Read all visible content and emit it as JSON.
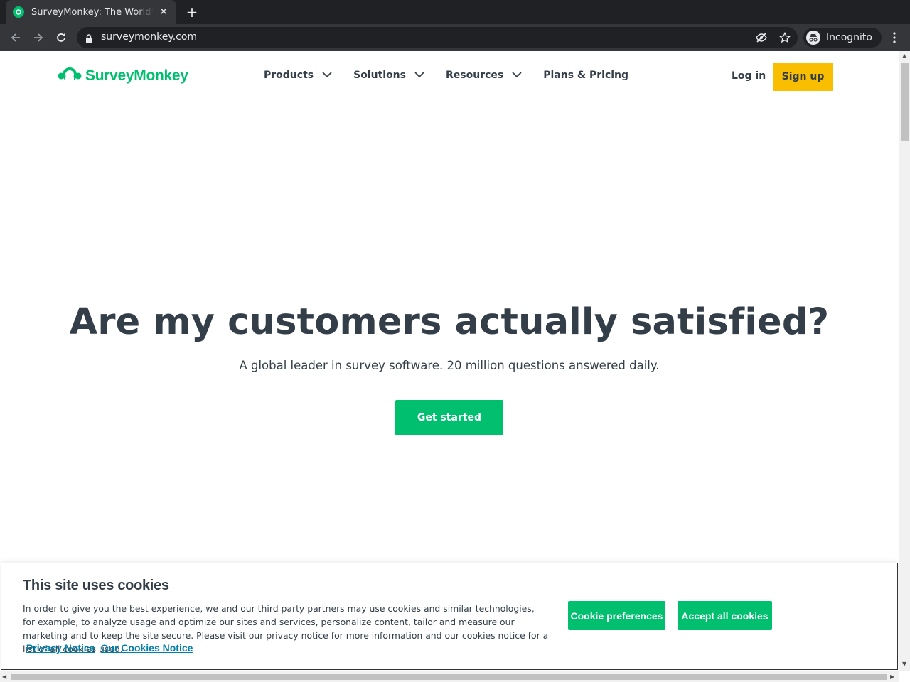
{
  "browser": {
    "tab_title": "SurveyMonkey: The World's Most Popular Free Online Survey Tool",
    "url": "surveymonkey.com",
    "profile_label": "Incognito"
  },
  "header": {
    "logo_text": "SurveyMonkey",
    "nav": [
      {
        "label": "Products",
        "has_dropdown": true
      },
      {
        "label": "Solutions",
        "has_dropdown": true
      },
      {
        "label": "Resources",
        "has_dropdown": true
      },
      {
        "label": "Plans & Pricing",
        "has_dropdown": false
      }
    ],
    "login_label": "Log in",
    "signup_label": "Sign up"
  },
  "hero": {
    "title": "Are my customers actually satisfied?",
    "subtitle": "A global leader in survey software. 20 million questions answered daily.",
    "cta_label": "Get started"
  },
  "cookie_banner": {
    "title": "This site uses cookies",
    "body": "In order to give you the best experience, we and our third party partners may use cookies and similar technologies, for example, to analyze usage and optimize our sites and services, personalize content, tailor and measure our marketing and to keep the site secure. Please visit our privacy notice for more information and our cookies notice for a list of all cookies used.",
    "privacy_link": "Privacy Notice",
    "cookies_link": "Our Cookies Notice",
    "preferences_label": "Cookie preferences",
    "accept_label": "Accept all cookies"
  },
  "colors": {
    "brand_green": "#00bf6f",
    "signup_yellow": "#f9be00",
    "text_dark": "#333e48",
    "link_blue": "#007faa"
  },
  "icons": [
    "back-icon",
    "forward-icon",
    "reload-icon",
    "lock-icon",
    "eye-off-icon",
    "star-icon",
    "incognito-icon",
    "menu-kebab-icon",
    "chevron-down-icon",
    "close-icon",
    "plus-icon"
  ]
}
